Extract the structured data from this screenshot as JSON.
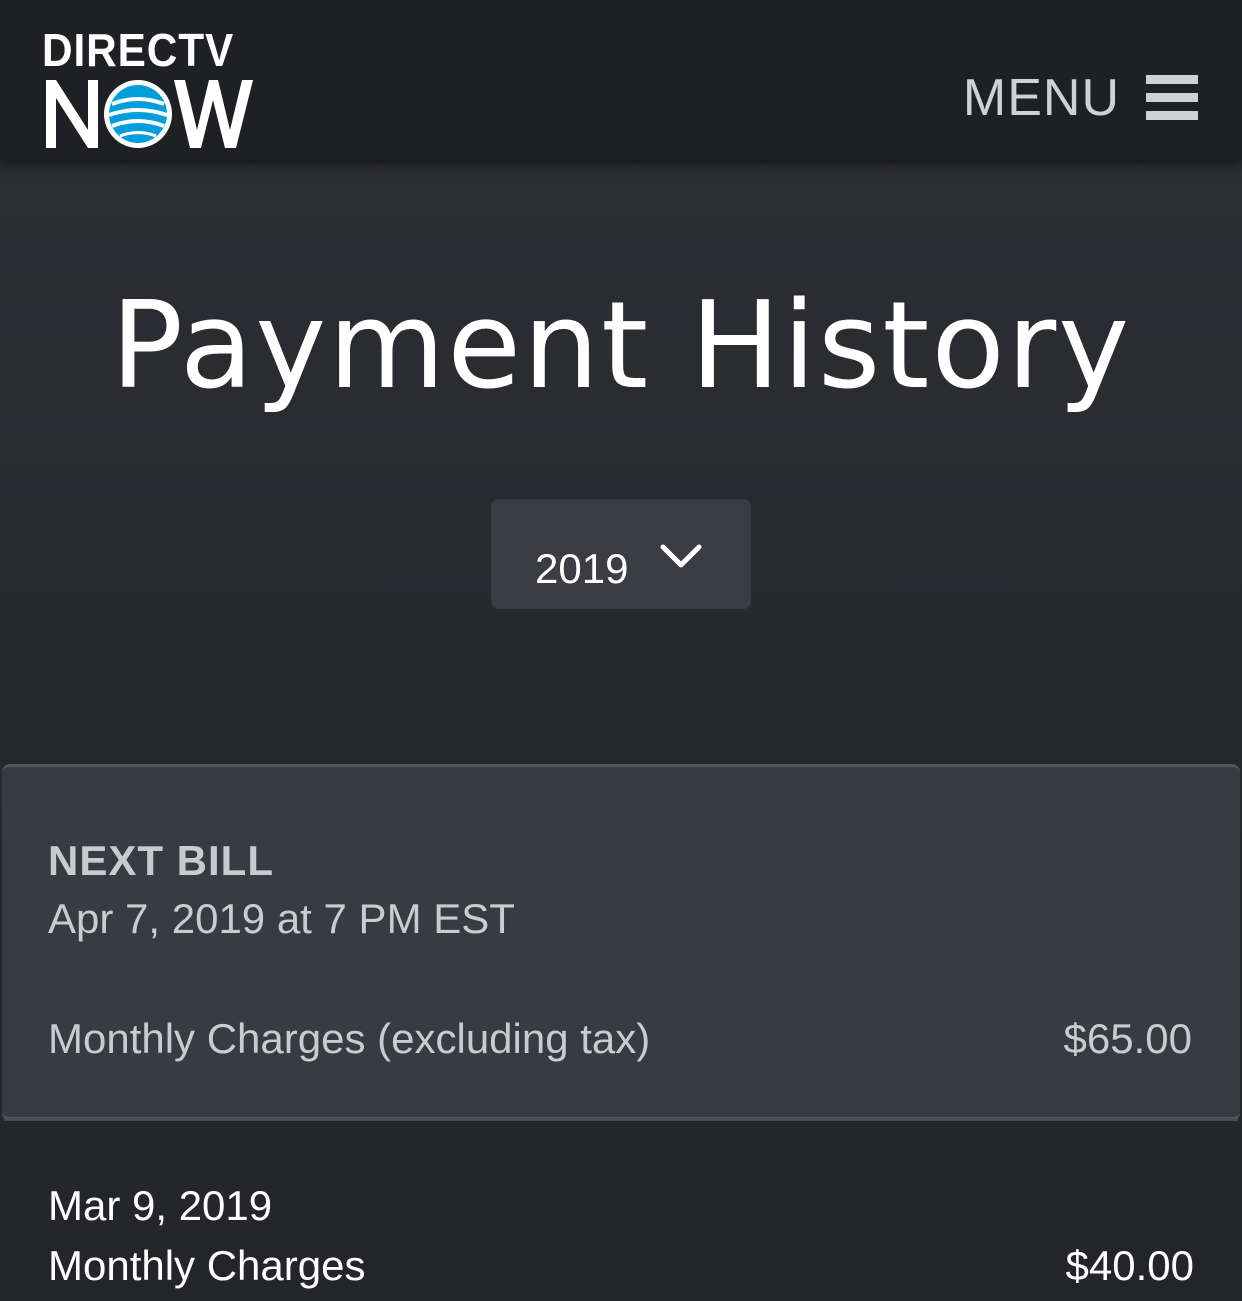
{
  "header": {
    "logo_top": "DIRECTV",
    "logo_bottom": "NOW",
    "menu_label": "MENU",
    "menu_icon": "hamburger-icon"
  },
  "page": {
    "title": "Payment History"
  },
  "year_filter": {
    "selected": "2019",
    "icon": "chevron-down-icon"
  },
  "next_bill": {
    "label": "NEXT BILL",
    "date": "Apr 7, 2019 at 7 PM EST",
    "charge_label": "Monthly Charges (excluding tax)",
    "charge_amount": "$65.00"
  },
  "payments": [
    {
      "date": "Mar 9, 2019",
      "description": "Monthly Charges",
      "amount": "$40.00"
    }
  ],
  "colors": {
    "header_bg": "#1f2024",
    "page_bg": "#27292d",
    "card_bg": "#393b40",
    "att_globe_blue": "#009fdb"
  }
}
